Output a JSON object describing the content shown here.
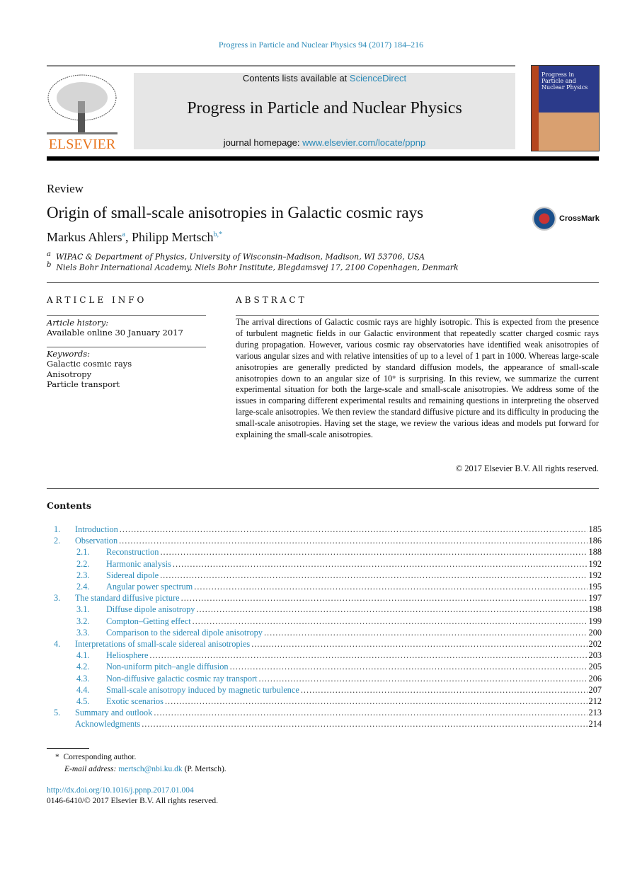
{
  "journal_ref": "Progress in Particle and Nuclear Physics 94 (2017) 184–216",
  "banner": {
    "contents_prefix": "Contents lists available at ",
    "contents_link": "ScienceDirect",
    "journal_title": "Progress in Particle and Nuclear Physics",
    "homepage_prefix": "journal homepage: ",
    "homepage_link": "www.elsevier.com/locate/ppnp"
  },
  "publisher_logo": "ELSEVIER",
  "cover_text": "Progress in Particle and Nuclear Physics",
  "article_type": "Review",
  "title": "Origin of small-scale anisotropies in Galactic cosmic rays",
  "crossmark": "CrossMark",
  "authors": [
    {
      "name": "Markus Ahlers",
      "sup": "a"
    },
    {
      "name": "Philipp Mertsch",
      "sup": "b,*"
    }
  ],
  "affiliations": [
    {
      "sup": "a",
      "text": "WIPAC & Department of Physics, University of Wisconsin–Madison, Madison, WI 53706, USA"
    },
    {
      "sup": "b",
      "text": "Niels Bohr International Academy, Niels Bohr Institute, Blegdamsvej 17, 2100 Copenhagen, Denmark"
    }
  ],
  "article_info": {
    "heading": "ARTICLE INFO",
    "history_label": "Article history:",
    "history": "Available online 30 January 2017",
    "keywords_label": "Keywords:",
    "keywords": [
      "Galactic cosmic rays",
      "Anisotropy",
      "Particle transport"
    ]
  },
  "abstract": {
    "heading": "ABSTRACT",
    "text": "The arrival directions of Galactic cosmic rays are highly isotropic. This is expected from the presence of turbulent magnetic fields in our Galactic environment that repeatedly scatter charged cosmic rays during propagation. However, various cosmic ray observatories have identified weak anisotropies of various angular sizes and with relative intensities of up to a level of 1 part in 1000. Whereas large-scale anisotropies are generally predicted by standard diffusion models, the appearance of small-scale anisotropies down to an angular size of 10° is surprising. In this review, we summarize the current experimental situation for both the large-scale and small-scale anisotropies. We address some of the issues in comparing different experimental results and remaining questions in interpreting the observed large-scale anisotropies. We then review the standard diffusive picture and its difficulty in producing the small-scale anisotropies. Having set the stage, we review the various ideas and models put forward for explaining the small-scale anisotropies.",
    "copyright": "© 2017 Elsevier B.V. All rights reserved."
  },
  "contents": {
    "heading": "Contents",
    "items": [
      {
        "num": "1.",
        "title": "Introduction",
        "page": "185",
        "level": 1
      },
      {
        "num": "2.",
        "title": "Observation",
        "page": "186",
        "level": 1
      },
      {
        "num": "2.1.",
        "title": "Reconstruction",
        "page": "188",
        "level": 2
      },
      {
        "num": "2.2.",
        "title": "Harmonic analysis",
        "page": "192",
        "level": 2
      },
      {
        "num": "2.3.",
        "title": "Sidereal dipole",
        "page": "192",
        "level": 2
      },
      {
        "num": "2.4.",
        "title": "Angular power spectrum",
        "page": "195",
        "level": 2
      },
      {
        "num": "3.",
        "title": "The standard diffusive picture",
        "page": "197",
        "level": 1
      },
      {
        "num": "3.1.",
        "title": "Diffuse dipole anisotropy",
        "page": "198",
        "level": 2
      },
      {
        "num": "3.2.",
        "title": "Compton–Getting effect",
        "page": "199",
        "level": 2
      },
      {
        "num": "3.3.",
        "title": "Comparison to the sidereal dipole anisotropy",
        "page": "200",
        "level": 2
      },
      {
        "num": "4.",
        "title": "Interpretations of small-scale sidereal anisotropies",
        "page": "202",
        "level": 1
      },
      {
        "num": "4.1.",
        "title": "Heliosphere",
        "page": "203",
        "level": 2
      },
      {
        "num": "4.2.",
        "title": "Non-uniform pitch–angle diffusion",
        "page": "205",
        "level": 2
      },
      {
        "num": "4.3.",
        "title": "Non-diffusive galactic cosmic ray transport",
        "page": "206",
        "level": 2
      },
      {
        "num": "4.4.",
        "title": "Small-scale anisotropy induced by magnetic turbulence",
        "page": "207",
        "level": 2
      },
      {
        "num": "4.5.",
        "title": "Exotic scenarios",
        "page": "212",
        "level": 2
      },
      {
        "num": "5.",
        "title": "Summary and outlook",
        "page": "213",
        "level": 1
      },
      {
        "num": "",
        "title": "Acknowledgments",
        "page": "214",
        "level": 1
      }
    ]
  },
  "footnote": {
    "mark": "*",
    "text": "Corresponding author.",
    "email_label": "E-mail address: ",
    "email": "mertsch@nbi.ku.dk",
    "email_suffix": " (P. Mertsch)."
  },
  "doi": "http://dx.doi.org/10.1016/j.ppnp.2017.01.004",
  "issn_copyright": "0146-6410/© 2017 Elsevier B.V. All rights reserved.",
  "colors": {
    "link": "#2a8ab8",
    "elsevier_orange": "#e8731a"
  }
}
